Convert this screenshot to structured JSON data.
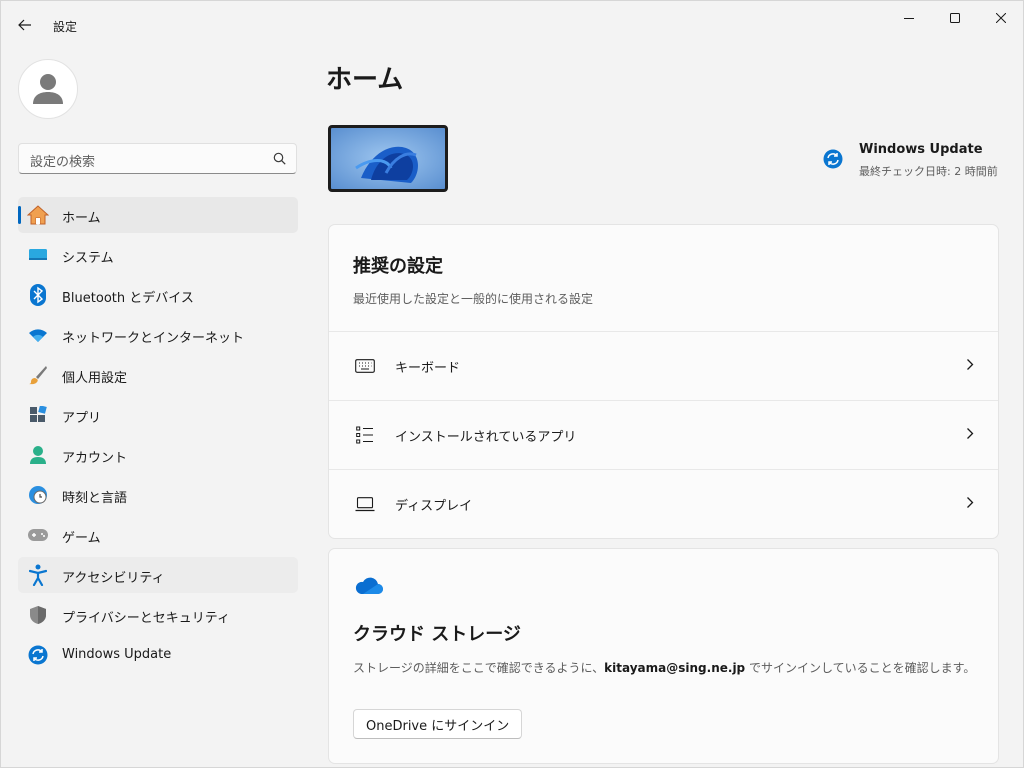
{
  "app": {
    "title": "設定"
  },
  "search": {
    "placeholder": "設定の検索"
  },
  "sidebar": {
    "items": [
      {
        "label": "ホーム",
        "icon": "home-icon"
      },
      {
        "label": "システム",
        "icon": "system-icon"
      },
      {
        "label": "Bluetooth とデバイス",
        "icon": "bluetooth-icon"
      },
      {
        "label": "ネットワークとインターネット",
        "icon": "wifi-icon"
      },
      {
        "label": "個人用設定",
        "icon": "brush-icon"
      },
      {
        "label": "アプリ",
        "icon": "apps-icon"
      },
      {
        "label": "アカウント",
        "icon": "account-icon"
      },
      {
        "label": "時刻と言語",
        "icon": "time-language-icon"
      },
      {
        "label": "ゲーム",
        "icon": "gamepad-icon"
      },
      {
        "label": "アクセシビリティ",
        "icon": "accessibility-icon"
      },
      {
        "label": "プライバシーとセキュリティ",
        "icon": "shield-icon"
      },
      {
        "label": "Windows Update",
        "icon": "windows-update-icon"
      }
    ]
  },
  "main": {
    "title": "ホーム",
    "windows_update": {
      "title": "Windows Update",
      "subtitle": "最終チェック日時: 2 時間前"
    },
    "recommended": {
      "title": "推奨の設定",
      "subtitle": "最近使用した設定と一般的に使用される設定",
      "rows": [
        {
          "label": "キーボード",
          "icon": "keyboard-icon"
        },
        {
          "label": "インストールされているアプリ",
          "icon": "list-icon"
        },
        {
          "label": "ディスプレイ",
          "icon": "laptop-icon"
        }
      ]
    },
    "cloud": {
      "title": "クラウド ストレージ",
      "desc_before": "ストレージの詳細をここで確認できるように、",
      "email": "kitayama@sing.ne.jp",
      "desc_after": " でサインインしていることを確認します。",
      "button": "OneDrive にサインイン"
    }
  },
  "colors": {
    "accent": "#0067c0",
    "window_bg": "#f3f3f3",
    "card_bg": "#fbfbfb"
  }
}
